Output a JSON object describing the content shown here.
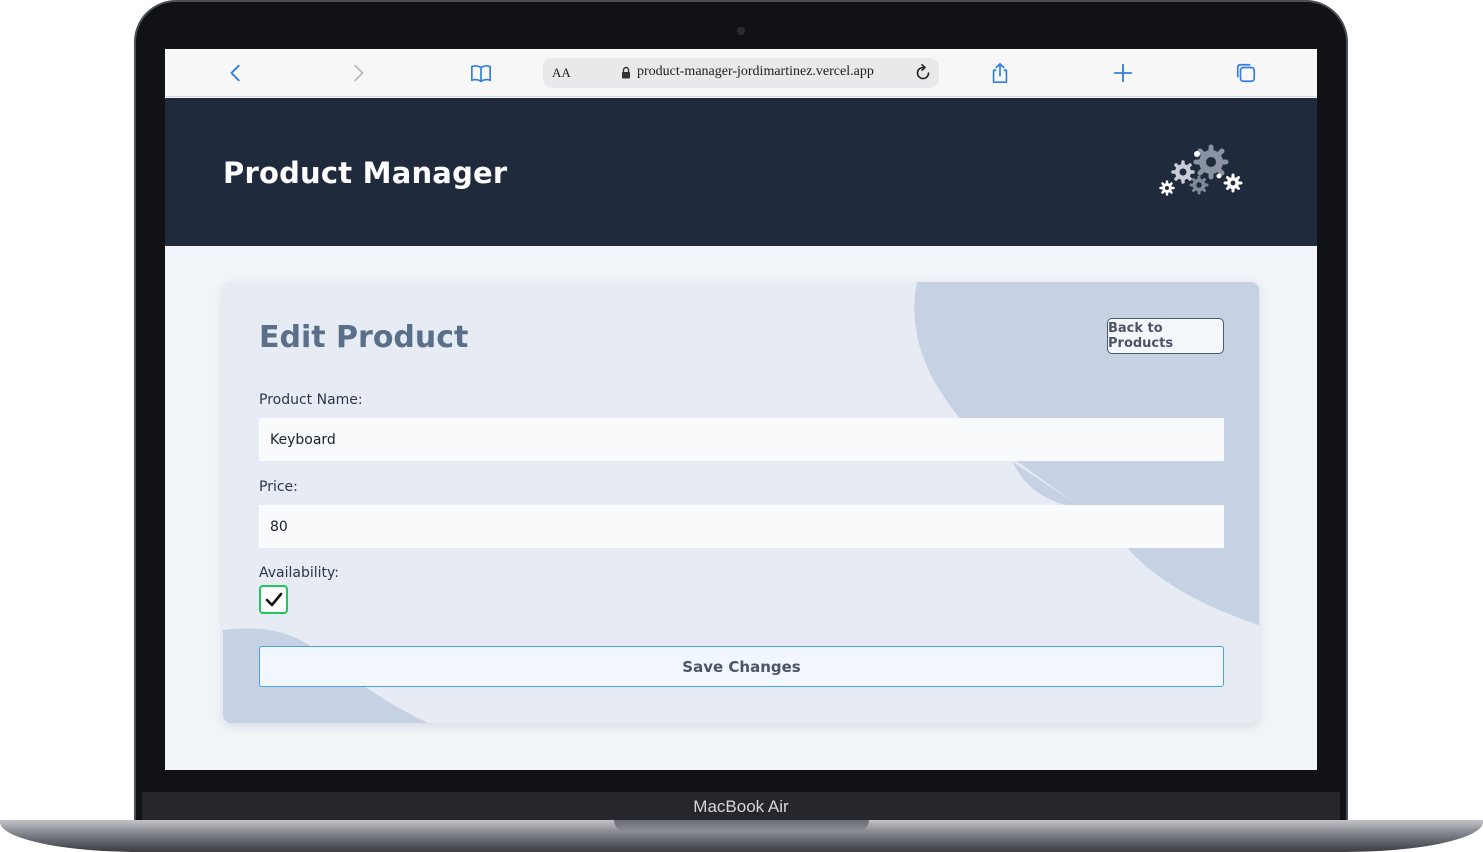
{
  "device": {
    "label": "MacBook Air"
  },
  "browser": {
    "text_size_label": "AA",
    "url": "product-manager-jordimartinez.vercel.app",
    "icons": [
      "chevron-left-icon",
      "chevron-right-icon",
      "book-icon",
      "lock-icon",
      "reload-icon",
      "share-icon",
      "plus-icon",
      "tabs-icon"
    ],
    "accent_color": "#2f7de1"
  },
  "header": {
    "title": "Product Manager",
    "logo_icon": "gears-icon"
  },
  "form": {
    "title": "Edit Product",
    "back_label": "Back to Products",
    "name_label": "Product Name:",
    "name_value": "Keyboard",
    "price_label": "Price:",
    "price_value": "80",
    "availability_label": "Availability:",
    "availability_checked": true,
    "save_label": "Save Changes"
  },
  "colors": {
    "header_bg": "#1f2a3c",
    "card_bg": "#e6ebf4",
    "checkbox_border": "#22c55e",
    "save_border": "#4aa3df"
  }
}
